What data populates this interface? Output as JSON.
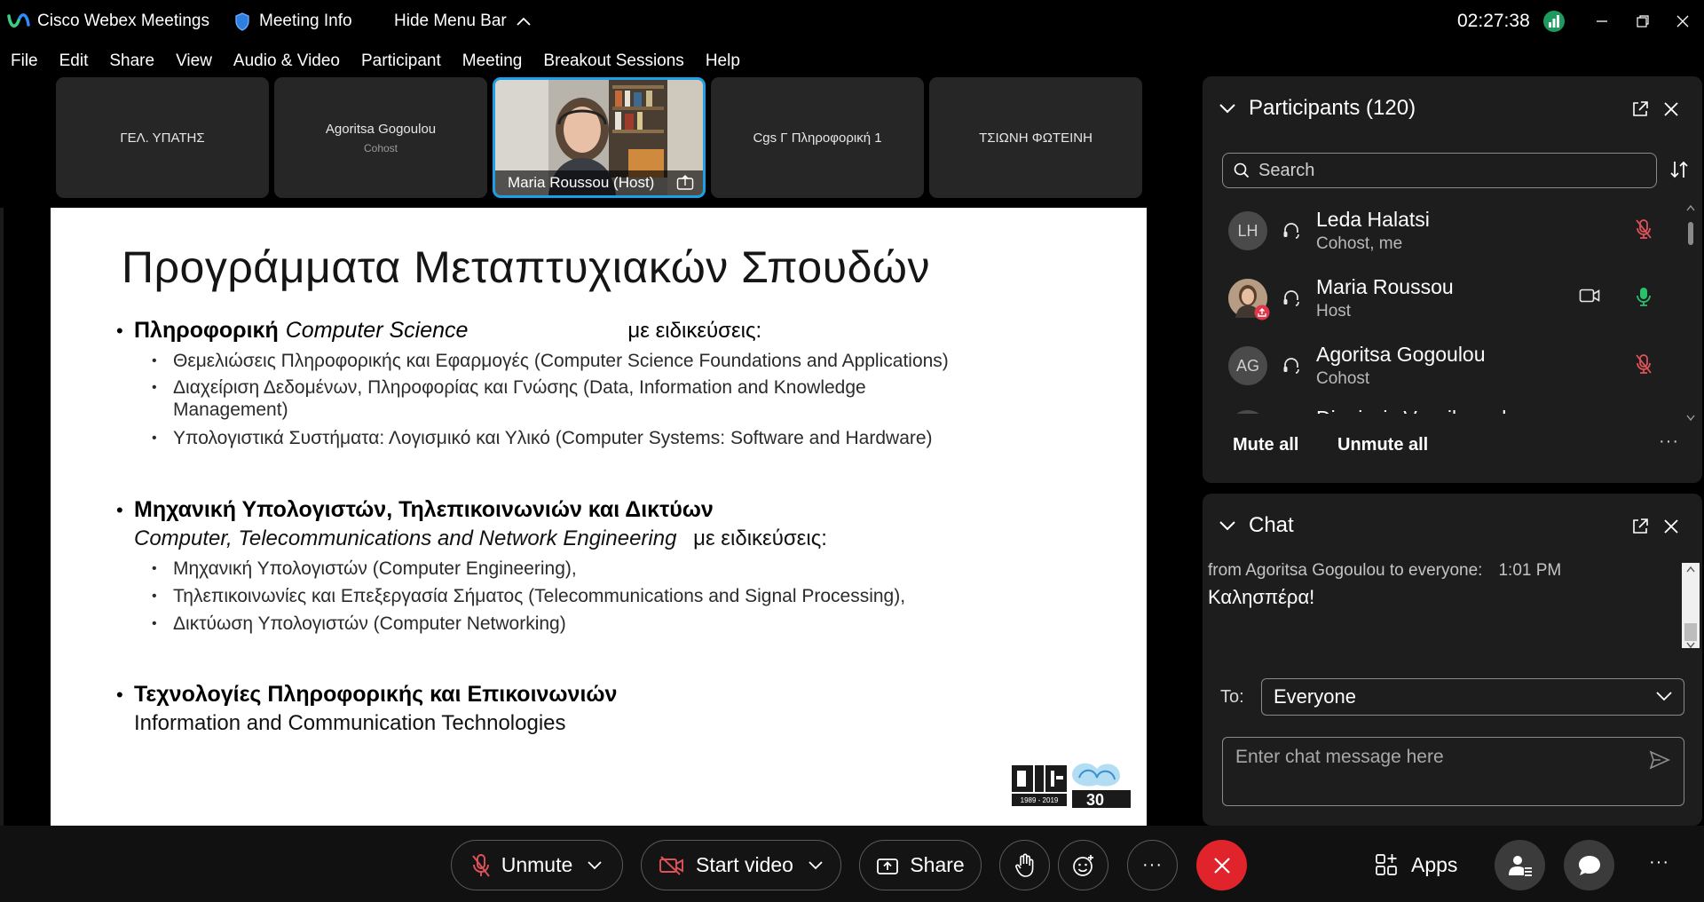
{
  "titlebar": {
    "app_name": "Cisco Webex Meetings",
    "meeting_info": "Meeting Info",
    "hide_menu": "Hide Menu Bar",
    "time": "02:27:38"
  },
  "menu": [
    "File",
    "Edit",
    "Share",
    "View",
    "Audio & Video",
    "Participant",
    "Meeting",
    "Breakout Sessions",
    "Help"
  ],
  "video_strip": [
    {
      "name": "ΓΕΛ. ΥΠΑΤΗΣ",
      "role": ""
    },
    {
      "name": "Agoritsa Gogoulou",
      "role": "Cohost"
    },
    {
      "name": "Maria Roussou  (Host)",
      "role": ""
    },
    {
      "name": "Cgs Γ Πληροφορική 1",
      "role": ""
    },
    {
      "name": "ΤΣΙΩΝΗ ΦΩΤΕΙΝΗ",
      "role": ""
    }
  ],
  "slide": {
    "title": "Προγράμματα Μεταπτυχιακών Σπουδών",
    "sections": [
      {
        "bold": "Πληροφορική",
        "italic": "Computer Science",
        "suffix": "με ειδικεύσεις:",
        "sub": "",
        "items": [
          "Θεμελιώσεις Πληροφορικής και Εφαρμογές (Computer Science Foundations and Applications)",
          "Διαχείριση Δεδομένων, Πληροφορίας και Γνώσης (Data, Information and Knowledge Management)",
          "Υπολογιστικά Συστήματα: Λογισμικό και Υλικό (Computer Systems: Software and Hardware)"
        ]
      },
      {
        "bold": "Μηχανική Υπολογιστών, Τηλεπικοινωνιών και Δικτύων",
        "italic": "Computer, Telecommunications and Network Engineering",
        "suffix": "με ειδικεύσεις:",
        "items": [
          "Μηχανική Υπολογιστών (Computer Engineering),",
          "Τηλεπικοινωνίες και Επεξεργασία Σήματος (Telecommunications and Signal Processing),",
          "Δικτύωση Υπολογιστών (Computer Networking)"
        ]
      },
      {
        "bold": "Τεχνολογίες Πληροφορικής και Επικοινωνιών",
        "sub": "Information and Communication Technologies",
        "items": []
      }
    ],
    "logo_text": "30",
    "logo_years": "1989 - 2019"
  },
  "participants": {
    "title": "Participants (120)",
    "search_placeholder": "Search",
    "list": [
      {
        "initials": "LH",
        "name": "Leda Halatsi",
        "role": "Cohost, me",
        "mic": "muted"
      },
      {
        "initials": "",
        "name": "Maria Roussou",
        "role": "Host",
        "mic": "active"
      },
      {
        "initials": "AG",
        "name": "Agoritsa Gogoulou",
        "role": "Cohost",
        "mic": "muted"
      },
      {
        "initials": "",
        "name": "Dionissis Vassilopoulos",
        "role": "",
        "mic": "muted"
      }
    ],
    "mute_all": "Mute all",
    "unmute_all": "Unmute all"
  },
  "chat": {
    "title": "Chat",
    "from": "from Agoritsa Gogoulou to everyone:",
    "time": "1:01 PM",
    "message": "Καλησπέρα!",
    "to_label": "To:",
    "to_value": "Everyone",
    "input_placeholder": "Enter chat message here"
  },
  "toolbar": {
    "unmute": "Unmute",
    "start_video": "Start video",
    "share": "Share",
    "apps": "Apps"
  },
  "colors": {
    "accent_blue": "#1aa0e6",
    "leave_red": "#e1242c",
    "mic_muted": "#e0525a",
    "mic_active": "#2bbf6a",
    "panel_bg": "#1d1d1d"
  }
}
